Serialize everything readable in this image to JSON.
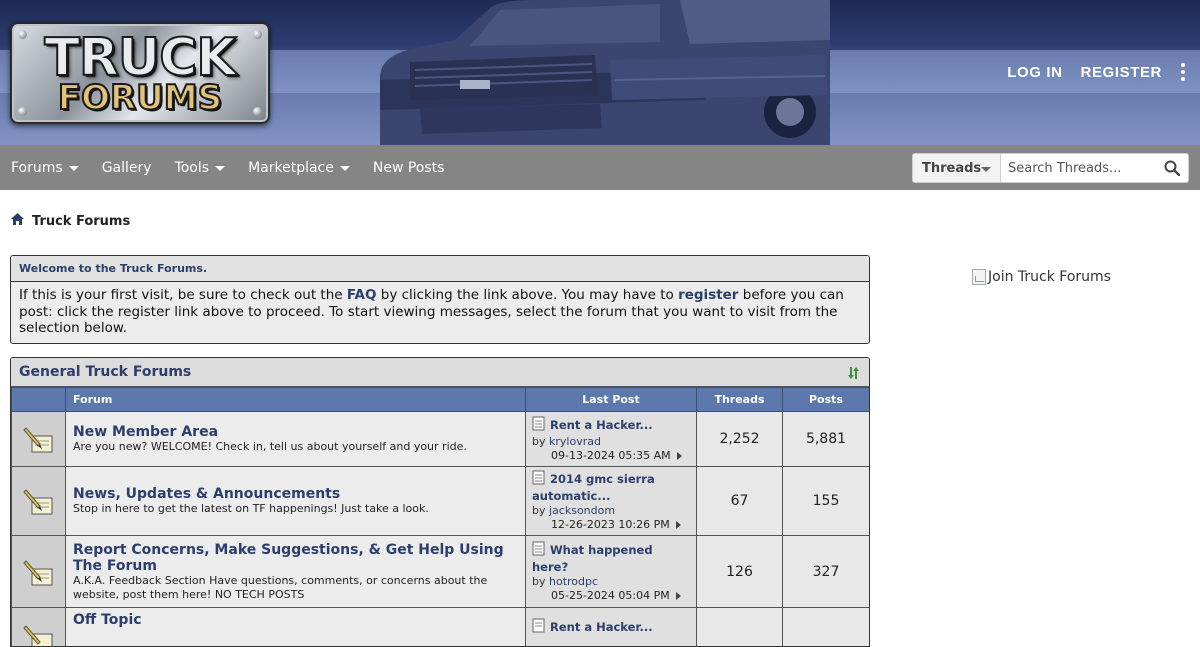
{
  "header": {
    "logo_line1": "TRUCK",
    "logo_line2": "FORUMS",
    "login_label": "LOG IN",
    "register_label": "REGISTER"
  },
  "nav": {
    "items": [
      {
        "label": "Forums",
        "has_dropdown": true
      },
      {
        "label": "Gallery",
        "has_dropdown": false
      },
      {
        "label": "Tools",
        "has_dropdown": true
      },
      {
        "label": "Marketplace",
        "has_dropdown": true
      },
      {
        "label": "New Posts",
        "has_dropdown": false
      }
    ],
    "search_scope": "Threads",
    "search_placeholder": "Search Threads..."
  },
  "breadcrumb": {
    "label": "Truck Forums"
  },
  "welcome": {
    "title": "Welcome to the Truck Forums.",
    "text_1": "If this is your first visit, be sure to check out the ",
    "faq_link": "FAQ",
    "text_2": " by clicking the link above. You may have to ",
    "register_link": "register",
    "text_3": " before you can post: click the register link above to proceed. To start viewing messages, select the forum that you want to visit from the selection below."
  },
  "forum_block": {
    "title": "General Truck Forums",
    "columns": {
      "forum": "Forum",
      "last_post": "Last Post",
      "threads": "Threads",
      "posts": "Posts"
    },
    "rows": [
      {
        "name": "New Member Area",
        "description": "Are you new? WELCOME! Check in, tell us about yourself and your ride.",
        "last_post_title": "Rent a Hacker...",
        "last_post_by": "by ",
        "last_post_user": "krylovrad",
        "last_post_date": "09-13-2024 05:35 AM",
        "threads": "2,252",
        "posts": "5,881"
      },
      {
        "name": "News, Updates & Announcements",
        "description": "Stop in here to get the latest on TF happenings! Just take a look.",
        "last_post_title": "2014 gmc sierra automatic...",
        "last_post_by": "by ",
        "last_post_user": "jacksondom",
        "last_post_date": "12-26-2023 10:26 PM",
        "threads": "67",
        "posts": "155"
      },
      {
        "name": "Report Concerns, Make Suggestions, & Get Help Using The Forum",
        "description": "A.K.A. Feedback Section Have questions, comments, or concerns about the website, post them here! NO TECH POSTS",
        "last_post_title": "What happened here?",
        "last_post_by": "by ",
        "last_post_user": "hotrodpc",
        "last_post_date": "05-25-2024 05:04 PM",
        "threads": "126",
        "posts": "327"
      },
      {
        "name": "Off Topic",
        "description": "",
        "last_post_title": "Rent a Hacker...",
        "last_post_by": "",
        "last_post_user": "",
        "last_post_date": "",
        "threads": "",
        "posts": ""
      }
    ]
  },
  "sidebar": {
    "join_alt": "Join Truck Forums"
  },
  "colors": {
    "header_dark": "#1e2a55",
    "nav_bg": "#858585",
    "table_header": "#5d78ad",
    "link": "#2c3e6b"
  },
  "icons": [
    "kebab-menu-icon",
    "search-icon",
    "home-icon",
    "collapse-icon",
    "forum-status-icon",
    "last-post-doc-icon",
    "goto-post-icon",
    "broken-image-icon"
  ]
}
